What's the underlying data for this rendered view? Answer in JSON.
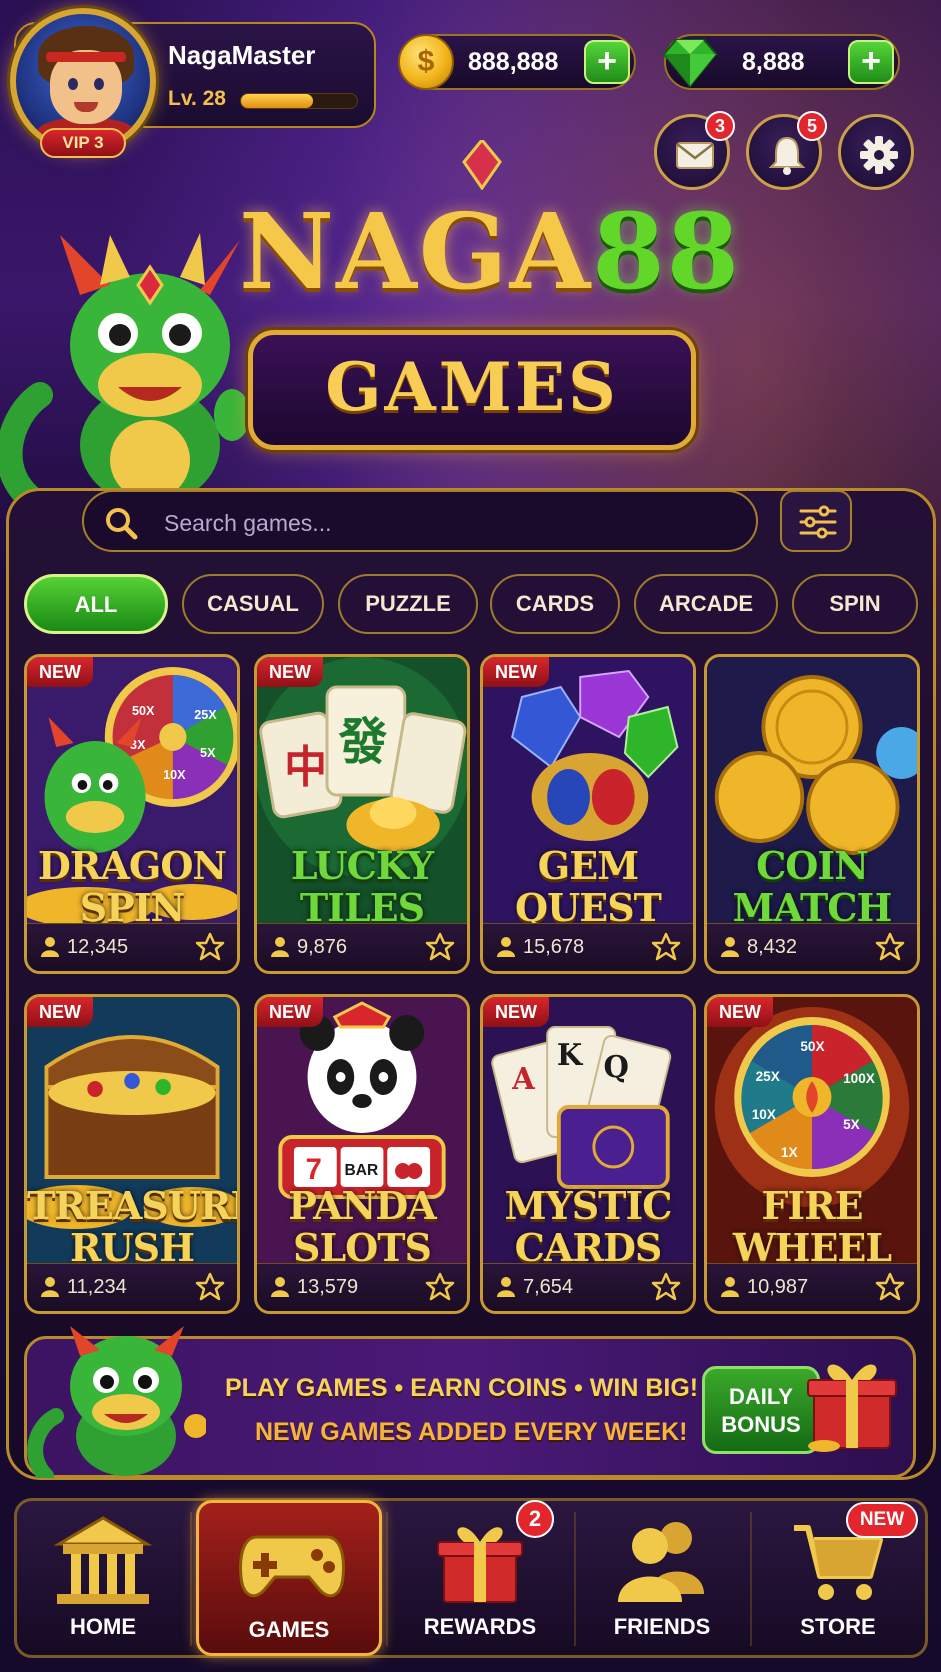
{
  "colors": {
    "accent_gold": "#f6c84a",
    "accent_green": "#56d136",
    "badge_red": "#e2262b",
    "background": "#1c0a38"
  },
  "profile": {
    "username": "NagaMaster",
    "level": "Lv. 28",
    "xp_progress": 0.62,
    "vip": "VIP 3",
    "avatar_icon": "hero-avatar"
  },
  "currencies": {
    "coins": {
      "value": "888,888",
      "icon": "coin-icon",
      "add_icon": "plus-icon"
    },
    "gems": {
      "value": "8,888",
      "icon": "gem-icon",
      "add_icon": "plus-icon"
    }
  },
  "top_actions": {
    "mail": {
      "icon": "mail-icon",
      "badge": "3"
    },
    "notifications": {
      "icon": "bell-icon",
      "badge": "5"
    },
    "settings": {
      "icon": "gear-icon"
    }
  },
  "logo": {
    "title_part1": "NAGA",
    "title_part2": "88",
    "subtitle": "GAMES"
  },
  "search": {
    "placeholder": "Search games...",
    "icon": "search-icon",
    "filter_icon": "sliders-icon"
  },
  "categories": [
    {
      "label": "ALL",
      "active": true
    },
    {
      "label": "CASUAL",
      "active": false
    },
    {
      "label": "PUZZLE",
      "active": false
    },
    {
      "label": "CARDS",
      "active": false
    },
    {
      "label": "ARCADE",
      "active": false
    },
    {
      "label": "SPIN",
      "active": false
    }
  ],
  "games": [
    {
      "badge": "NEW",
      "title": "DRAGON\nSPIN",
      "players": "12,345"
    },
    {
      "badge": "NEW",
      "title": "LUCKY\nTILES",
      "players": "9,876"
    },
    {
      "badge": "NEW",
      "title": "GEM\nQUEST",
      "players": "15,678"
    },
    {
      "badge": "",
      "title": "COIN\nMATCH",
      "players": "8,432"
    },
    {
      "badge": "NEW",
      "title": "TREASURE\nRUSH",
      "players": "11,234"
    },
    {
      "badge": "NEW",
      "title": "PANDA\nSLOTS",
      "players": "13,579"
    },
    {
      "badge": "NEW",
      "title": "MYSTIC\nCARDS",
      "players": "7,654"
    },
    {
      "badge": "NEW",
      "title": "FIRE\nWHEEL",
      "players": "10,987"
    }
  ],
  "wheel_labels": {
    "dragon": [
      "50X",
      "25X",
      "5X",
      "10X",
      "3X"
    ],
    "fire": [
      "50X",
      "100X",
      "5X",
      "25X",
      "10X",
      "1X"
    ],
    "slot": "BAR",
    "mahjong": [
      "中",
      "發"
    ]
  },
  "banner": {
    "line1": "PLAY GAMES  •  EARN COINS  •  WIN BIG!",
    "line2": "NEW GAMES ADDED EVERY WEEK!",
    "bonus_line1": "DAILY",
    "bonus_line2": "BONUS"
  },
  "nav": [
    {
      "label": "HOME",
      "icon": "temple-icon"
    },
    {
      "label": "GAMES",
      "icon": "gamepad-icon",
      "active": true
    },
    {
      "label": "REWARDS",
      "icon": "gift-icon",
      "badge": "2"
    },
    {
      "label": "FRIENDS",
      "icon": "friends-icon"
    },
    {
      "label": "STORE",
      "icon": "cart-icon",
      "badge": "NEW"
    }
  ]
}
